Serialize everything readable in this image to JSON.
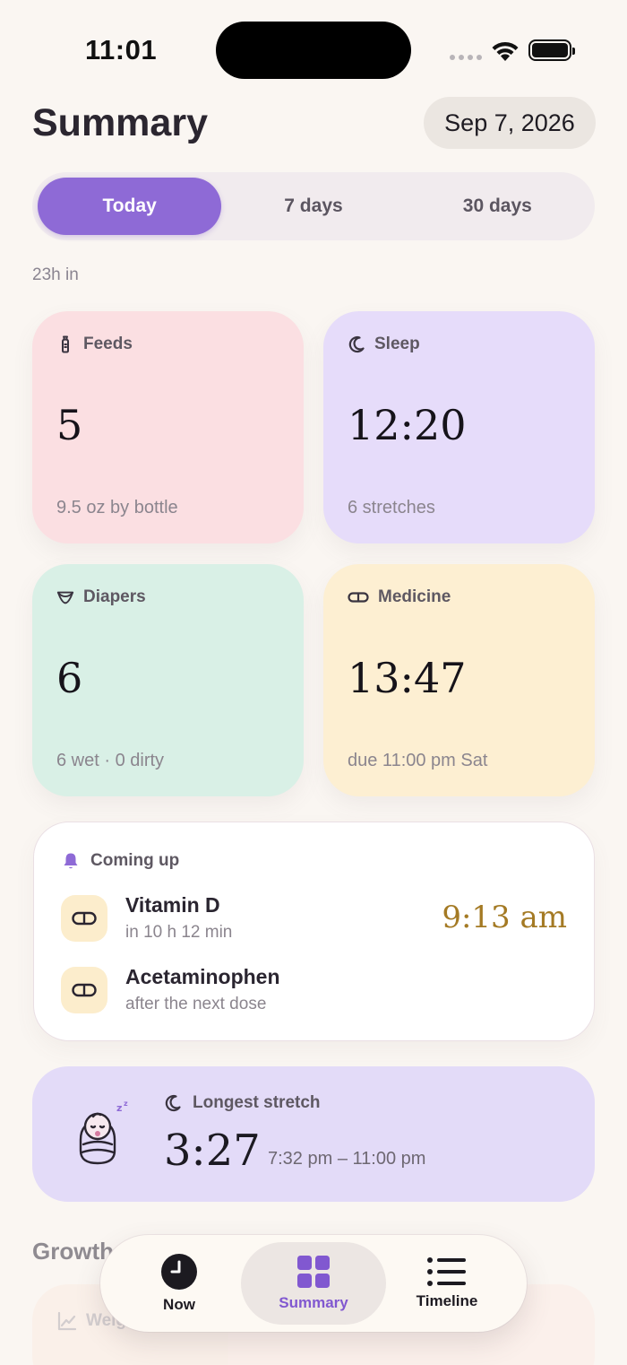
{
  "status_bar": {
    "time": "11:01"
  },
  "header": {
    "title": "Summary",
    "date": "Sep 7, 2026"
  },
  "range_tabs": [
    {
      "label": "Today",
      "active": true
    },
    {
      "label": "7 days",
      "active": false
    },
    {
      "label": "30 days",
      "active": false
    }
  ],
  "elapsed": "23h in",
  "cards": {
    "feeds": {
      "label": "Feeds",
      "value": "5",
      "detail": "9.5 oz by bottle",
      "icon": "bottle-icon",
      "color": "#fbdfe2"
    },
    "sleep": {
      "label": "Sleep",
      "value": "12:20",
      "detail": "6 stretches",
      "icon": "moon-icon",
      "color": "#e6dcfa"
    },
    "diapers": {
      "label": "Diapers",
      "value": "6",
      "detail": "6 wet · 0 dirty",
      "icon": "diaper-icon",
      "color": "#d9f0e6"
    },
    "medicine": {
      "label": "Medicine",
      "value": "13:47",
      "detail": "due 11:00 pm Sat",
      "icon": "pill-icon",
      "color": "#fdefd2"
    }
  },
  "coming_up": {
    "label": "Coming up",
    "items": [
      {
        "name": "Vitamin D",
        "note": "in 10 h 12 min",
        "time": "9:13 am"
      },
      {
        "name": "Acetaminophen",
        "note": "after the next dose"
      }
    ]
  },
  "longest_stretch": {
    "label": "Longest stretch",
    "duration": "3:27",
    "range": "7:32 pm – 11:00 pm"
  },
  "growth": {
    "title": "Growth",
    "weight_label": "Weight"
  },
  "tabbar": [
    {
      "label": "Now",
      "icon": "clock-icon",
      "active": false
    },
    {
      "label": "Summary",
      "icon": "grid-icon",
      "active": true
    },
    {
      "label": "Timeline",
      "icon": "list-icon",
      "active": false
    }
  ],
  "accent": "#8e6ad6"
}
